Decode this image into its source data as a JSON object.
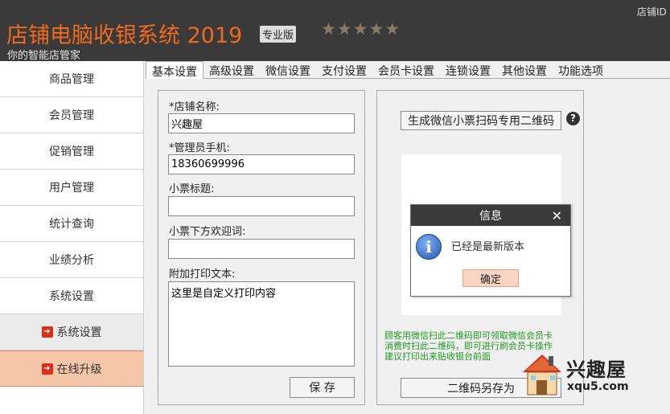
{
  "header": {
    "title": "店铺电脑收银系统 2019",
    "edition": "专业版",
    "rating": "★★★★★",
    "subtitle": "你的智能店管家",
    "store_id_label": "店铺ID"
  },
  "sidebar": {
    "items": [
      {
        "label": "商品管理"
      },
      {
        "label": "会员管理"
      },
      {
        "label": "促销管理"
      },
      {
        "label": "用户管理"
      },
      {
        "label": "统计查询"
      },
      {
        "label": "业绩分析"
      },
      {
        "label": "系统设置"
      }
    ],
    "sub_items": [
      {
        "label": "系统设置",
        "active": false
      },
      {
        "label": "在线升级",
        "active": true
      }
    ]
  },
  "tabs": [
    {
      "label": "基本设置",
      "active": true
    },
    {
      "label": "高级设置"
    },
    {
      "label": "微信设置"
    },
    {
      "label": "支付设置"
    },
    {
      "label": "会员卡设置"
    },
    {
      "label": "连锁设置"
    },
    {
      "label": "其他设置"
    },
    {
      "label": "功能选项"
    }
  ],
  "form": {
    "store_name_label": "*店铺名称:",
    "store_name_value": "兴趣屋",
    "admin_phone_label": "*管理员手机:",
    "admin_phone_value": "18360699996",
    "receipt_title_label": "小票标题:",
    "receipt_title_value": "",
    "receipt_footer_label": "小票下方欢迎词:",
    "receipt_footer_value": "",
    "extra_print_label": "附加打印文本:",
    "extra_print_value": "这里是自定义打印内容",
    "save_label": "保 存"
  },
  "qr_panel": {
    "generate_label": "生成微信小票扫码专用二维码",
    "help": "?",
    "note_lines": [
      "顾客用微信扫此二维码即可领取微信会员卡",
      "消费时扫此二维码，即可进行刷会员卡操作",
      "建议打印出来贴收银台前面"
    ],
    "save_as_label": "二维码另存为"
  },
  "dialog": {
    "title": "信息",
    "close": "✕",
    "info_glyph": "i",
    "message": "已经是最新版本",
    "ok_label": "确定"
  },
  "watermark": {
    "name": "兴趣屋",
    "url": "xqu5.com"
  }
}
